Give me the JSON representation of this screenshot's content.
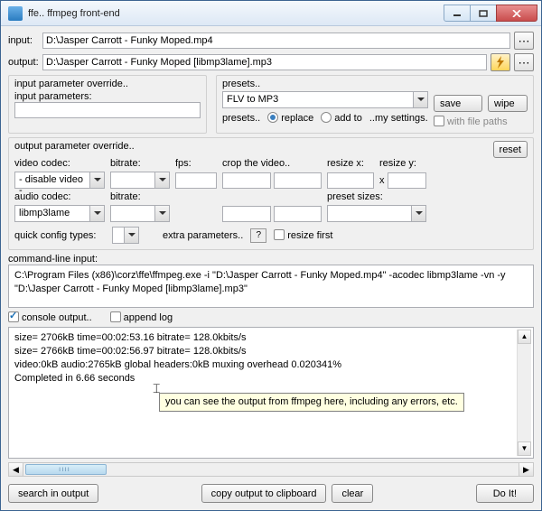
{
  "window": {
    "title": "ffe.. ffmpeg front-end"
  },
  "io": {
    "input_label": "input:",
    "output_label": "output:",
    "input_value": "D:\\Jasper Carrott - Funky Moped.mp4",
    "output_value": "D:\\Jasper Carrott - Funky Moped [libmp3lame].mp3"
  },
  "input_override": {
    "group": "input parameter override..",
    "label": "input parameters:",
    "value": ""
  },
  "presets": {
    "group": "presets..",
    "selected": "FLV to MP3",
    "save": "save",
    "wipe": "wipe",
    "line2_prefix": "presets..",
    "replace": "replace",
    "addto": "add to",
    "mysettings": "..my settings.",
    "with_file_paths": "with file paths"
  },
  "out_override": {
    "group": "output parameter override..",
    "video_codec": "video codec:",
    "video_codec_value": "- disable video -",
    "bitrate": "bitrate:",
    "fps": "fps:",
    "crop": "crop the video..",
    "resizex": "resize x:",
    "resizey": "resize y:",
    "x": "x",
    "audio_codec": "audio codec:",
    "audio_codec_value": "libmp3lame",
    "preset_sizes": "preset sizes:",
    "quick_config": "quick config types:",
    "extra_params": "extra parameters..",
    "resize_first": "resize first",
    "reset": "reset"
  },
  "cli": {
    "label": "command-line input:",
    "text": "C:\\Program Files (x86)\\corz\\ffe\\ffmpeg.exe  -i  \"D:\\Jasper Carrott - Funky Moped.mp4\"  -acodec libmp3lame  -vn  -y  \"D:\\Jasper Carrott - Funky Moped [libmp3lame].mp3\""
  },
  "console": {
    "check": "console output..",
    "append": "append log",
    "lines": [
      "size=    2706kB time=00:02:53.16 bitrate= 128.0kbits/s",
      "size=    2766kB time=00:02:56.97 bitrate= 128.0kbits/s",
      "video:0kB audio:2765kB global headers:0kB muxing overhead 0.020341%",
      "",
      "Completed in 6.66 seconds"
    ],
    "tooltip": "you can see the output from ffmpeg here, including any errors, etc."
  },
  "footer": {
    "search": "search in output",
    "copy": "copy output to clipboard",
    "clear": "clear",
    "doit": "Do It!"
  }
}
